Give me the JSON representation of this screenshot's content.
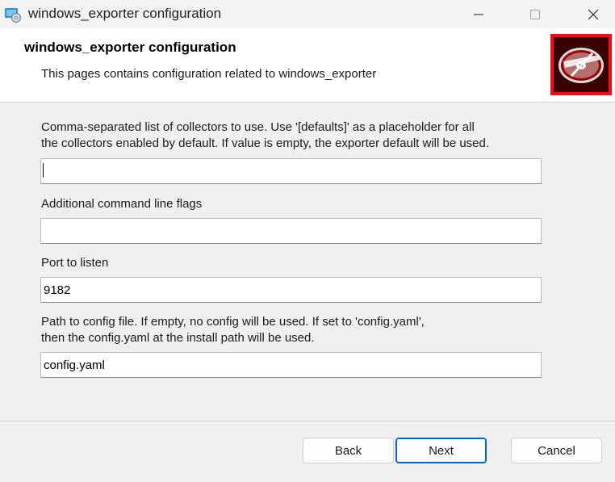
{
  "window": {
    "title": "windows_exporter configuration",
    "icon": "installer-disc-icon"
  },
  "title_buttons": [
    "minimize-icon",
    "maximize-icon",
    "close-icon"
  ],
  "banner": {
    "title": "windows_exporter configuration",
    "subtitle": "This pages contains configuration related to windows_exporter",
    "image": "disc-logo-icon",
    "image_color": "#ee1010"
  },
  "fields": [
    {
      "label_line1": "Comma-separated list of collectors to use. Use '[defaults]' as a placeholder for all",
      "label_line2": "the collectors enabled by default. If value is empty, the exporter default will be used.",
      "value": ""
    },
    {
      "label_line1": "Additional command line flags",
      "value": ""
    },
    {
      "label_line1": "Port to listen",
      "value": "9182"
    },
    {
      "label_line1": "Path to config file. If empty, no config will be used. If set to 'config.yaml',",
      "label_line2": "then the config.yaml at the install path will be used.",
      "value": "config.yaml"
    }
  ],
  "buttons": {
    "back": "Back",
    "next": "Next",
    "cancel": "Cancel"
  },
  "colors": {
    "accent": "#0067c0"
  }
}
